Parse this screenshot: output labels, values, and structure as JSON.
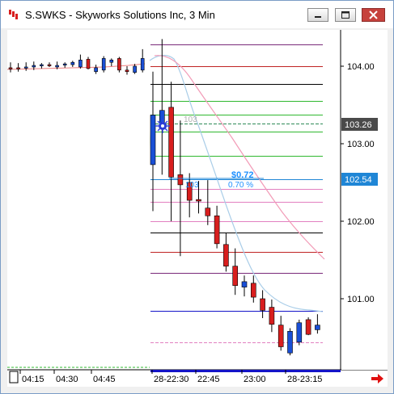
{
  "window": {
    "title": "S.SWKS - Skyworks Solutions Inc, 3 Min"
  },
  "price_axis": {
    "labels": [
      "104.00",
      "103.00",
      "102.00",
      "101.00"
    ],
    "current_price": "103.26",
    "order_price": "102.54"
  },
  "time_axis": {
    "labels": [
      "04:15",
      "04:30",
      "04:45",
      "28-22:30",
      "22:45",
      "23:00",
      "28-23:15"
    ]
  },
  "overlay": {
    "profit_amount": "$0.72",
    "profit_percent": "0.70 %",
    "entry_price_label": "103",
    "cursor_price_label": "103"
  },
  "colors": {
    "up_candle": "#1a4fd6",
    "down_candle": "#d81e1e",
    "current_price_tag": "#4a4a4a",
    "order_tag": "#1f86d6",
    "profit_text": "#1e90ff"
  },
  "chart_data": {
    "type": "candlestick",
    "x": [
      "04:15",
      "04:30",
      "04:45",
      "28-22:30",
      "22:45",
      "23:00",
      "28-23:15"
    ],
    "ylim": [
      100.1,
      104.55
    ],
    "candles": [
      {
        "o": 103.98,
        "h": 104.05,
        "l": 103.92,
        "c": 103.97
      },
      {
        "o": 103.98,
        "h": 104.04,
        "l": 103.93,
        "c": 103.97
      },
      {
        "o": 103.98,
        "h": 104.05,
        "l": 103.94,
        "c": 103.99
      },
      {
        "o": 103.99,
        "h": 104.06,
        "l": 103.95,
        "c": 104.01
      },
      {
        "o": 104.01,
        "h": 104.04,
        "l": 103.97,
        "c": 104.02
      },
      {
        "o": 104.02,
        "h": 104.05,
        "l": 103.99,
        "c": 104.01
      },
      {
        "o": 103.99,
        "h": 104.06,
        "l": 103.96,
        "c": 104.01
      },
      {
        "o": 104.02,
        "h": 104.05,
        "l": 103.98,
        "c": 104.03
      },
      {
        "o": 104.02,
        "h": 104.07,
        "l": 103.99,
        "c": 104.05
      },
      {
        "o": 103.99,
        "h": 104.15,
        "l": 103.97,
        "c": 104.08
      },
      {
        "o": 104.09,
        "h": 104.12,
        "l": 103.96,
        "c": 103.97
      },
      {
        "o": 103.93,
        "h": 104.02,
        "l": 103.9,
        "c": 103.98
      },
      {
        "o": 103.95,
        "h": 104.13,
        "l": 103.92,
        "c": 104.1
      },
      {
        "o": 104.05,
        "h": 104.1,
        "l": 104.0,
        "c": 104.08
      },
      {
        "o": 104.1,
        "h": 104.12,
        "l": 103.92,
        "c": 103.95
      },
      {
        "o": 103.95,
        "h": 104.0,
        "l": 103.89,
        "c": 103.93
      },
      {
        "o": 103.92,
        "h": 104.03,
        "l": 103.9,
        "c": 104.0
      },
      {
        "o": 103.95,
        "h": 104.22,
        "l": 103.92,
        "c": 104.1
      },
      {
        "o": 102.73,
        "h": 103.93,
        "l": 102.13,
        "c": 103.37
      },
      {
        "o": 103.2,
        "h": 104.35,
        "l": 102.6,
        "c": 103.43
      },
      {
        "o": 103.47,
        "h": 103.8,
        "l": 102.0,
        "c": 102.57
      },
      {
        "o": 102.6,
        "h": 103.3,
        "l": 101.55,
        "c": 102.47
      },
      {
        "o": 102.5,
        "h": 102.62,
        "l": 102.05,
        "c": 102.27
      },
      {
        "o": 102.28,
        "h": 102.52,
        "l": 102.1,
        "c": 102.26
      },
      {
        "o": 102.17,
        "h": 102.53,
        "l": 101.95,
        "c": 102.07
      },
      {
        "o": 102.07,
        "h": 102.2,
        "l": 101.65,
        "c": 101.71
      },
      {
        "o": 101.7,
        "h": 101.85,
        "l": 101.35,
        "c": 101.42
      },
      {
        "o": 101.42,
        "h": 101.65,
        "l": 101.05,
        "c": 101.17
      },
      {
        "o": 101.15,
        "h": 101.3,
        "l": 101.03,
        "c": 101.22
      },
      {
        "o": 101.2,
        "h": 101.3,
        "l": 100.95,
        "c": 101.02
      },
      {
        "o": 101.0,
        "h": 101.11,
        "l": 100.75,
        "c": 100.85
      },
      {
        "o": 100.89,
        "h": 100.99,
        "l": 100.57,
        "c": 100.67
      },
      {
        "o": 100.66,
        "h": 100.78,
        "l": 100.33,
        "c": 100.38
      },
      {
        "o": 100.3,
        "h": 100.62,
        "l": 100.27,
        "c": 100.58
      },
      {
        "o": 100.44,
        "h": 100.73,
        "l": 100.4,
        "c": 100.69
      },
      {
        "o": 100.73,
        "h": 100.76,
        "l": 100.53,
        "c": 100.54
      },
      {
        "o": 100.6,
        "h": 100.8,
        "l": 100.55,
        "c": 100.66
      }
    ],
    "horizontal_levels": [
      {
        "price": 104.28,
        "color": "#7a2a7a"
      },
      {
        "price": 104.0,
        "color": "#c02323"
      },
      {
        "price": 103.77,
        "color": "#000000"
      },
      {
        "price": 103.55,
        "color": "#2fb82f"
      },
      {
        "price": 103.37,
        "color": "#2fb82f"
      },
      {
        "price": 103.26,
        "color": "#2e8b57",
        "dash": true
      },
      {
        "price": 103.16,
        "color": "#2fb82f"
      },
      {
        "price": 102.84,
        "color": "#2fb82f"
      },
      {
        "price": 102.54,
        "color": "#1f86d6"
      },
      {
        "price": 102.42,
        "color": "#e27fc0"
      },
      {
        "price": 102.25,
        "color": "#e27fc0"
      },
      {
        "price": 102.0,
        "color": "#e27fc0"
      },
      {
        "price": 101.85,
        "color": "#000000"
      },
      {
        "price": 101.6,
        "color": "#c02323"
      },
      {
        "price": 101.33,
        "color": "#7a2a7a"
      },
      {
        "price": 100.84,
        "color": "#1414c8"
      },
      {
        "price": 100.44,
        "color": "#e27fc0",
        "dash": true
      }
    ]
  }
}
